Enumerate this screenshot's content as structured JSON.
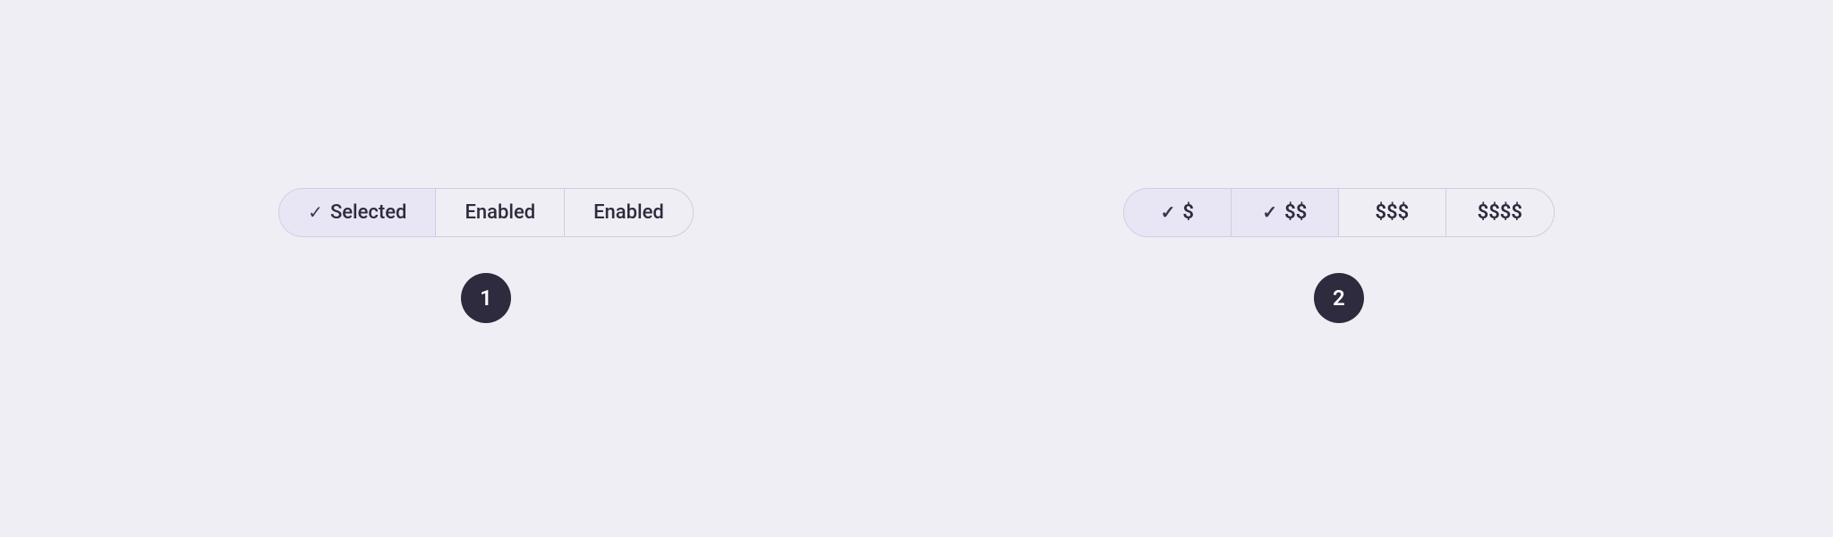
{
  "background": "#f0eef5",
  "example1": {
    "segments": [
      {
        "id": "selected",
        "label": "Selected",
        "state": "selected",
        "has_check": true
      },
      {
        "id": "enabled1",
        "label": "Enabled",
        "state": "enabled",
        "has_check": false
      },
      {
        "id": "enabled2",
        "label": "Enabled",
        "state": "enabled",
        "has_check": false
      }
    ],
    "badge": {
      "number": "1"
    }
  },
  "example2": {
    "segments": [
      {
        "id": "dollar1",
        "label": "$",
        "state": "selected",
        "has_check": true
      },
      {
        "id": "dollar2",
        "label": "$$",
        "state": "selected",
        "has_check": true
      },
      {
        "id": "dollar3",
        "label": "$$$",
        "state": "enabled",
        "has_check": false
      },
      {
        "id": "dollar4",
        "label": "$$$$",
        "state": "enabled",
        "has_check": false
      }
    ],
    "badge": {
      "number": "2"
    }
  }
}
